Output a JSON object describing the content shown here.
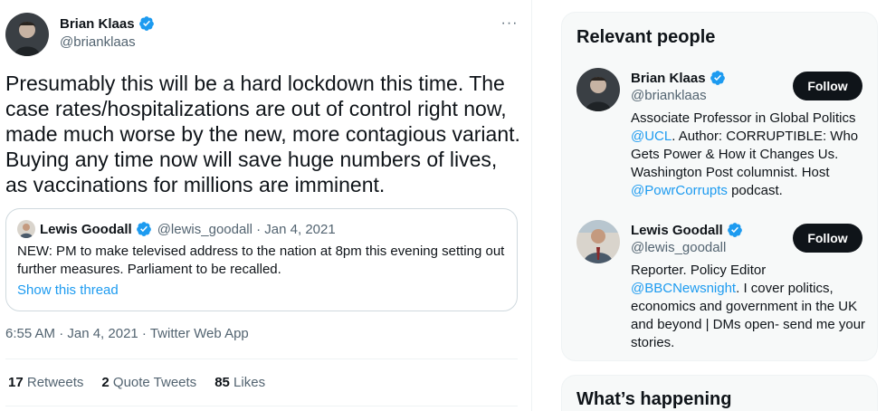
{
  "tweet": {
    "author_name": "Brian Klaas",
    "author_handle": "@brianklaas",
    "more_label": "···",
    "text": "Presumably this will be a hard lockdown this time. The case rates/hospitalizations are out of control right now, made much worse by the new, more contagious variant. Buying any time now will save huge numbers of lives, as vaccinations for millions are imminent.",
    "timestamp": "6:55 AM · Jan 4, 2021 · Twitter Web App",
    "stats": [
      {
        "count": "17",
        "label": "Retweets"
      },
      {
        "count": "2",
        "label": "Quote Tweets"
      },
      {
        "count": "85",
        "label": "Likes"
      }
    ]
  },
  "quote": {
    "author_name": "Lewis Goodall",
    "meta": "@lewis_goodall · Jan 4, 2021",
    "text": "NEW: PM to make televised address to the nation at 8pm this evening setting out further measures. Parliament to be recalled.",
    "link": "Show this thread"
  },
  "sidebar": {
    "relevant_title": "Relevant people",
    "people": [
      {
        "name": "Brian Klaas",
        "handle": "@brianklaas",
        "follow_label": "Follow",
        "bio_parts": [
          "Associate Professor in Global Politics ",
          "@UCL",
          ". Author: CORRUPTIBLE: Who Gets Power & How it Changes Us. Washington Post columnist. Host ",
          "@PowrCorrupts",
          " podcast."
        ]
      },
      {
        "name": "Lewis Goodall",
        "handle": "@lewis_goodall",
        "follow_label": "Follow",
        "bio_parts": [
          "Reporter. Policy Editor ",
          "@BBCNewsnight",
          ". I cover politics, economics and government in the UK and beyond | DMs open- send me your stories."
        ]
      }
    ],
    "happening_title": "What’s happening"
  },
  "colors": {
    "accent": "#1d9bf0",
    "text": "#0f1419",
    "muted": "#536471",
    "border": "#cfd9de",
    "card_bg": "#f7f9f9"
  },
  "icons": [
    "verified-badge-icon",
    "more-icon"
  ]
}
